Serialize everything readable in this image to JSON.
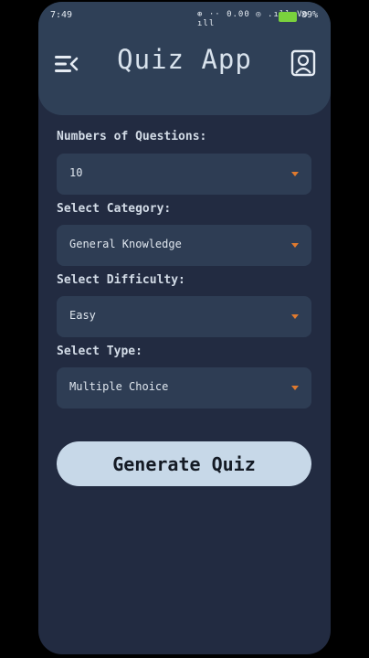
{
  "status_bar": {
    "time": "7:49",
    "icons_text": "⊕ ·· 0.00 ◎ .ıll Vo ıll",
    "battery_pct": "89%"
  },
  "header": {
    "title": "Quiz App",
    "menu_icon": "menu-icon",
    "profile_icon": "profile-icon"
  },
  "form": {
    "num_questions": {
      "label": "Numbers of Questions:",
      "value": "10"
    },
    "category": {
      "label": "Select Category:",
      "value": "General Knowledge"
    },
    "difficulty": {
      "label": "Select Difficulty:",
      "value": "Easy"
    },
    "type": {
      "label": "Select Type:",
      "value": "Multiple Choice"
    }
  },
  "actions": {
    "generate_label": "Generate Quiz"
  },
  "colors": {
    "background": "#222b41",
    "header": "#2f4057",
    "field": "#2e3d54",
    "caret": "#e07a2e",
    "button": "#c7d8e8"
  }
}
